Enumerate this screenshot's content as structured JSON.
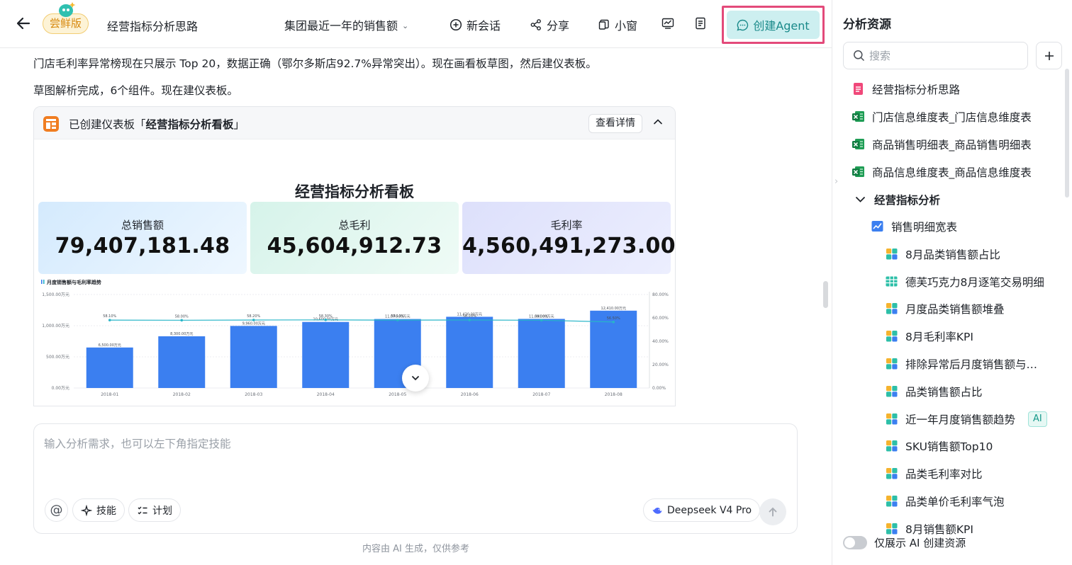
{
  "header": {
    "badge": "尝鲜版",
    "title": "经营指标分析思路",
    "session": "集团最近一年的销售额",
    "new_chat": "新会话",
    "share": "分享",
    "mini_window": "小窗",
    "create_agent": "创建Agent"
  },
  "chat": {
    "message1": "门店毛利率异常榜现在只展示 Top 20，数据正确（鄂尔多斯店92.7%异常突出）。现在画看板草图，然后建仪表板。",
    "message2": "草图解析完成，6个组件。现在建仪表板。",
    "card": {
      "title_prefix": "已创建仪表板「",
      "title_name": "经营指标分析看板",
      "title_suffix": "」",
      "detail_button": "查看详情"
    }
  },
  "dashboard": {
    "title": "经营指标分析看板",
    "kpis": [
      {
        "label": "总销售额",
        "value": "79,407,181.48"
      },
      {
        "label": "总毛利",
        "value": "45,604,912.73"
      },
      {
        "label": "毛利率",
        "value": "4,560,491,273.00%"
      }
    ]
  },
  "chart_data": {
    "type": "bar",
    "title": "月度销售额与毛利率趋势",
    "categories": [
      "2018-01",
      "2018-02",
      "2018-03",
      "2018-04",
      "2018-05",
      "2018-06",
      "2018-07",
      "2018-08"
    ],
    "series": [
      {
        "name": "销售额",
        "type": "bar",
        "axis": "left",
        "values": [
          6500,
          8300,
          9960,
          10600,
          11070,
          11430,
          11090,
          12410
        ],
        "color": "#3b7ff0"
      },
      {
        "name": "毛利率",
        "type": "line",
        "axis": "right",
        "values": [
          58.1,
          58.0,
          58.2,
          58.3,
          58.1,
          58.2,
          58.0,
          56.5
        ],
        "color": "#28b5c8"
      }
    ],
    "left_ticks": [
      "0.00万元",
      "500.00万元",
      "1,000.00万元",
      "1,500.00万元"
    ],
    "right_ticks": [
      "0.00%",
      "20.00%",
      "40.00%",
      "60.00%",
      "80.00%"
    ],
    "ylim_left": [
      0,
      15000
    ],
    "ylim_right": [
      0,
      80
    ],
    "grid": true
  },
  "input": {
    "placeholder": "输入分析需求，也可以左下角指定技能",
    "at": "@",
    "skill": "技能",
    "plan": "计划",
    "model": "Deepseek V4 Pro"
  },
  "footnote": "内容由 AI 生成，仅供参考",
  "sidebar": {
    "title": "分析资源",
    "search_placeholder": "搜索",
    "items": [
      {
        "label": "经营指标分析思路",
        "icon": "doc-icon"
      },
      {
        "label": "门店信息维度表_门店信息维度表",
        "icon": "excel-icon"
      },
      {
        "label": "商品销售明细表_商品销售明细表",
        "icon": "excel-icon"
      },
      {
        "label": "商品信息维度表_商品信息维度表",
        "icon": "excel-icon"
      },
      {
        "label": "经营指标分析",
        "icon": "chevron-down-icon"
      },
      {
        "label": "销售明细宽表",
        "icon": "dataset-icon"
      },
      {
        "label": "8月品类销售额占比",
        "icon": "chart-icon"
      },
      {
        "label": "德芙巧克力8月逐笔交易明细",
        "icon": "table-icon"
      },
      {
        "label": "月度品类销售额堆叠",
        "icon": "chart-icon"
      },
      {
        "label": "8月毛利率KPI",
        "icon": "chart-icon"
      },
      {
        "label": "排除异常后月度销售额与…",
        "icon": "chart-icon"
      },
      {
        "label": "品类销售额占比",
        "icon": "chart-icon"
      },
      {
        "label": "近一年月度销售额趋势",
        "icon": "chart-icon",
        "tag": "AI"
      },
      {
        "label": "SKU销售额Top10",
        "icon": "chart-icon"
      },
      {
        "label": "品类毛利率对比",
        "icon": "chart-icon"
      },
      {
        "label": "品类单价毛利率气泡",
        "icon": "chart-icon"
      },
      {
        "label": "8月销售额KPI",
        "icon": "chart-icon"
      }
    ],
    "footer_toggle": "仅展示 AI 创建资源"
  }
}
